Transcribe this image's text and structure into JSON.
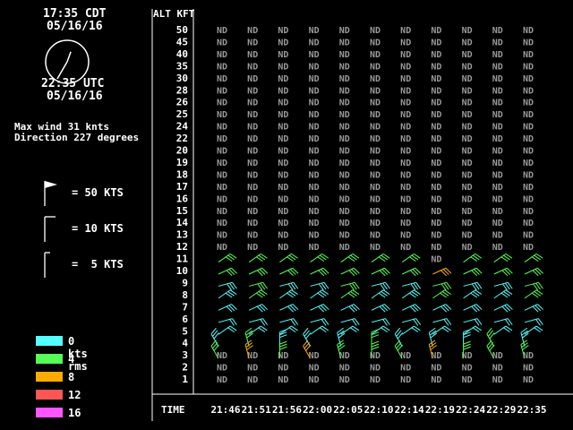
{
  "clock": {
    "local_time": "17:35 CDT",
    "local_date": "05/16/16",
    "utc_time": "22:35 UTC",
    "utc_date": "05/16/16",
    "hour_hand_deg": 20,
    "minute_hand_deg": 210
  },
  "summary": {
    "max_wind": "Max wind 31 knts",
    "direction": "Direction 227 degrees"
  },
  "barb_legend": [
    {
      "label": "= 50 KTS",
      "icon": "pennant-barb-icon"
    },
    {
      "label": "= 10 KTS",
      "icon": "full-barb-icon"
    },
    {
      "label": "=  5 KTS",
      "icon": "half-barb-icon"
    }
  ],
  "rms_legend": [
    {
      "label": "0 kts rms",
      "color": "#55ffff"
    },
    {
      "label": "4",
      "color": "#55ff55"
    },
    {
      "label": "8",
      "color": "#ffaa00"
    },
    {
      "label": "12",
      "color": "#ff5555"
    },
    {
      "label": "16",
      "color": "#ff55ff"
    }
  ],
  "axis": {
    "alt_header": "ALT KFT",
    "time_header": "TIME",
    "no_data_label": "ND"
  },
  "altitudes": [
    "50",
    "45",
    "40",
    "35",
    "30",
    "28",
    "26",
    "25",
    "24",
    "22",
    "20",
    "19",
    "18",
    "17",
    "16",
    "15",
    "14",
    "13",
    "12",
    "11",
    "10",
    "9",
    "8",
    "7",
    "6",
    "5",
    "4",
    "3",
    "2",
    "1"
  ],
  "times": [
    "21:46",
    "21:51",
    "21:56",
    "22:00",
    "22:05",
    "22:10",
    "22:14",
    "22:19",
    "22:24",
    "22:29",
    "22:35"
  ],
  "nd_rows": {
    "upper_all": [
      "50",
      "45",
      "40",
      "35",
      "30",
      "28",
      "26",
      "25",
      "24",
      "22",
      "20",
      "19",
      "18",
      "17",
      "16",
      "15",
      "14",
      "13",
      "12"
    ],
    "row_11_columns": [
      "22:19"
    ],
    "low_all": [
      "3",
      "2",
      "1"
    ]
  },
  "wind_rows": [
    "11",
    "10",
    "9",
    "8",
    "7",
    "6",
    "5",
    "4",
    "3"
  ]
}
